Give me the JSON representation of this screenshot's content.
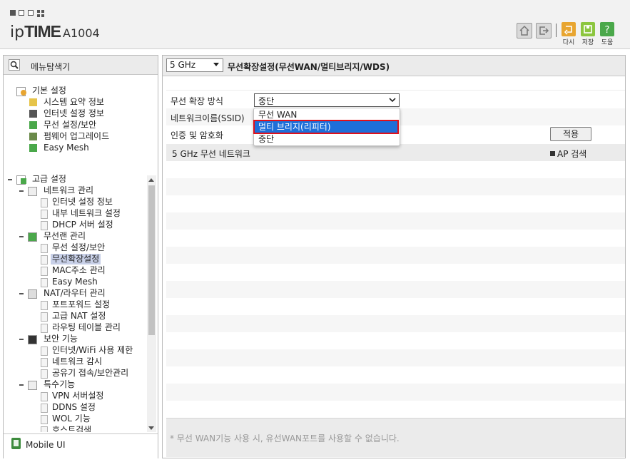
{
  "header": {
    "logo_ip": "ip",
    "logo_time": "TIME",
    "model": "A1004",
    "actions": [
      {
        "label": "다시",
        "icon": "refresh-icon",
        "color": "#e8a530"
      },
      {
        "label": "저장",
        "icon": "save-icon",
        "color": "#8cc63f"
      },
      {
        "label": "도움",
        "icon": "help-icon",
        "color": "#4aa84a"
      }
    ]
  },
  "sidebar": {
    "title": "메뉴탐색기",
    "basic": {
      "label": "기본 설정",
      "items": [
        "시스템 요약 정보",
        "인터넷 설정 정보",
        "무선 설정/보안",
        "펌웨어 업그레이드",
        "Easy Mesh"
      ]
    },
    "advanced": {
      "label": "고급 설정",
      "groups": [
        {
          "label": "네트워크 관리",
          "items": [
            "인터넷 설정 정보",
            "내부 네트워크 설정",
            "DHCP 서버 설정"
          ]
        },
        {
          "label": "무선랜 관리",
          "items": [
            "무선 설정/보안",
            "무선확장설정",
            "MAC주소 관리",
            "Easy Mesh"
          ]
        },
        {
          "label": "NAT/라우터 관리",
          "items": [
            "포트포워드 설정",
            "고급 NAT 설정",
            "라우팅 테이블 관리"
          ]
        },
        {
          "label": "보안 기능",
          "items": [
            "인터넷/WiFi 사용 제한",
            "네트워크 감시",
            "공유기 접속/보안관리"
          ]
        },
        {
          "label": "특수기능",
          "items": [
            "VPN 서버설정",
            "DDNS 설정",
            "WOL 기능",
            "호스트검색"
          ]
        }
      ]
    },
    "selected_item": "무선확장설정",
    "mobile": "Mobile UI"
  },
  "main": {
    "band_select": "5 GHz",
    "title": "무선확장설정(무선WAN/멀티브리지/WDS)",
    "fields": {
      "mode_label": "무선 확장 방식",
      "mode_value": "중단",
      "ssid_label": "네트워크이름(SSID)",
      "auth_label": "인증 및 암호화"
    },
    "dropdown_options": [
      "무선 WAN",
      "멀티 브리지(리피터)",
      "중단"
    ],
    "highlighted_option": "멀티 브리지(리피터)",
    "apply": "적용",
    "network_list_title": "5 GHz 무선 네트워크",
    "ap_scan": "AP 검색",
    "footnote": "* 무선 WAN기능 사용 시, 유선WAN포트를 사용할 수 없습니다."
  }
}
